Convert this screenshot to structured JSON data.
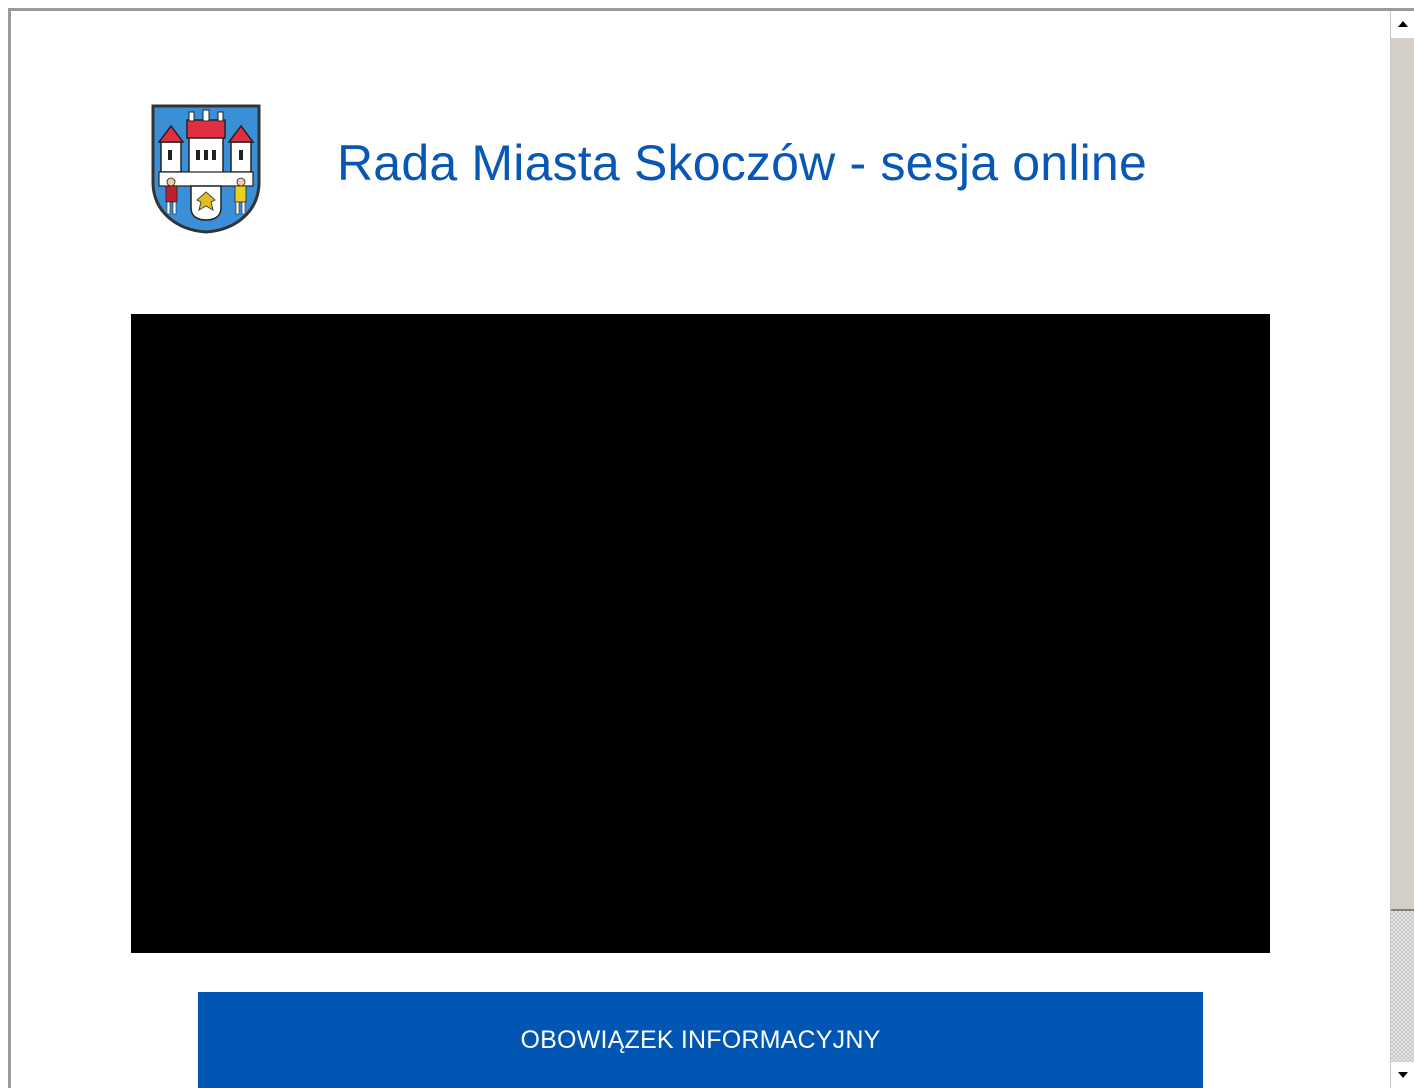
{
  "header": {
    "title": "Rada Miasta Skoczów - sesja online",
    "logo_icon": "coat-of-arms-icon",
    "brand_color": "#0857b5"
  },
  "main": {
    "video_player": {
      "background": "#000000"
    },
    "info_button": {
      "label": "OBOWIĄZEK INFORMACYJNY",
      "color": "#0156b3"
    }
  },
  "scrollbar": {
    "up_icon": "arrow-up-icon",
    "down_icon": "arrow-down-icon"
  }
}
